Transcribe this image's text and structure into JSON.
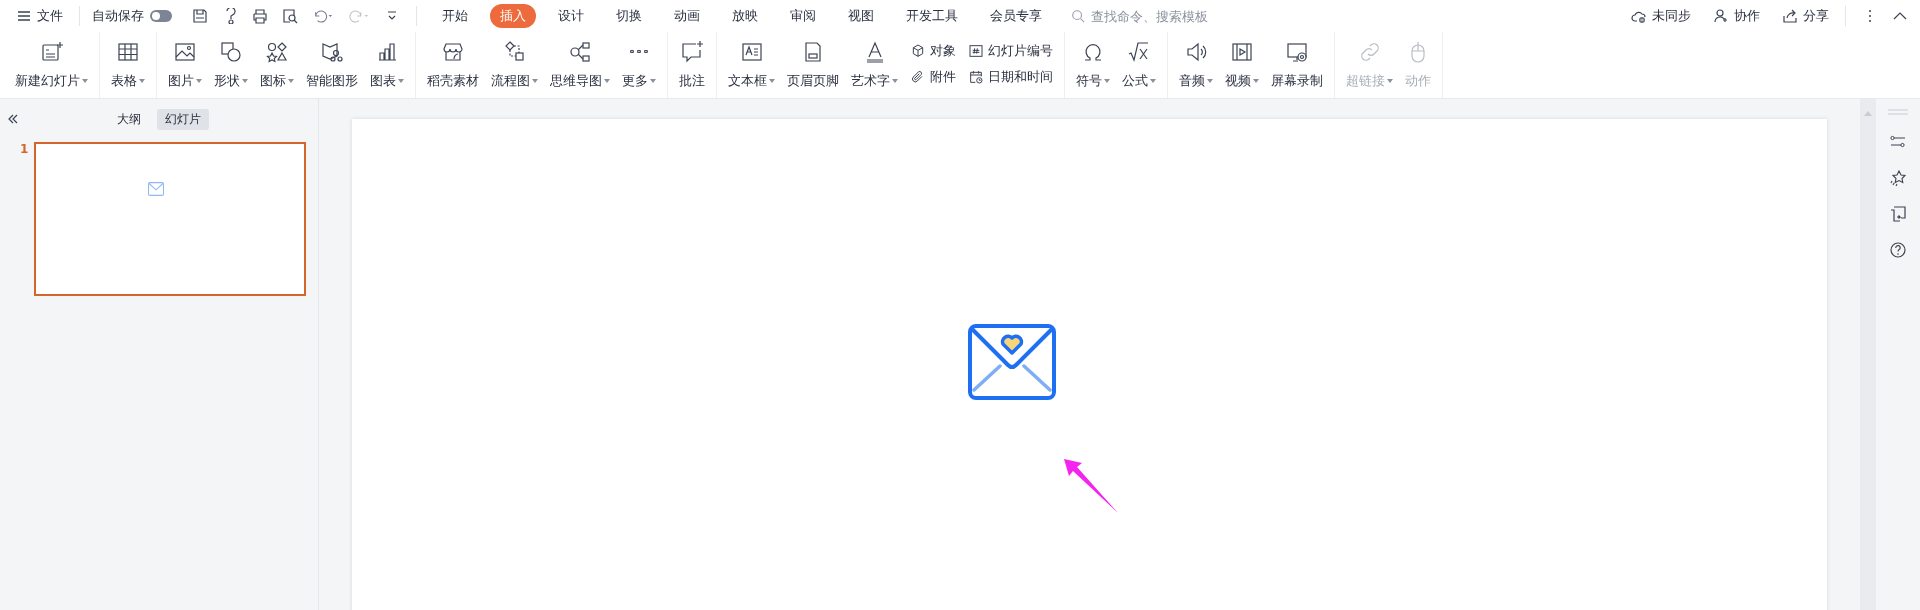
{
  "title_bar": {
    "file_menu": "文件",
    "autosave": {
      "label": "自动保存",
      "on": false
    }
  },
  "tabs": [
    {
      "label": "开始",
      "selected": false
    },
    {
      "label": "插入",
      "selected": true
    },
    {
      "label": "设计",
      "selected": false
    },
    {
      "label": "切换",
      "selected": false
    },
    {
      "label": "动画",
      "selected": false
    },
    {
      "label": "放映",
      "selected": false
    },
    {
      "label": "审阅",
      "selected": false
    },
    {
      "label": "视图",
      "selected": false
    },
    {
      "label": "开发工具",
      "selected": false
    },
    {
      "label": "会员专享",
      "selected": false
    }
  ],
  "search": {
    "placeholder": "查找命令、搜索模板"
  },
  "top_actions": [
    "未同步",
    "协作",
    "分享"
  ],
  "ribbon": [
    [
      {
        "kind": "large",
        "label": "新建幻灯片",
        "dropdown": true,
        "disabled": false
      }
    ],
    [
      {
        "kind": "large",
        "label": "表格",
        "dropdown": true,
        "disabled": false
      }
    ],
    [
      {
        "kind": "large",
        "label": "图片",
        "dropdown": true,
        "disabled": false
      },
      {
        "kind": "large",
        "label": "形状",
        "dropdown": true,
        "disabled": false
      },
      {
        "kind": "large",
        "label": "图标",
        "dropdown": true,
        "disabled": false
      },
      {
        "kind": "large",
        "label": "智能图形",
        "dropdown": false,
        "disabled": false
      },
      {
        "kind": "large",
        "label": "图表",
        "dropdown": true,
        "disabled": false
      }
    ],
    [
      {
        "kind": "large",
        "label": "稻壳素材",
        "dropdown": false,
        "disabled": false
      },
      {
        "kind": "large",
        "label": "流程图",
        "dropdown": true,
        "disabled": false
      },
      {
        "kind": "large",
        "label": "思维导图",
        "dropdown": true,
        "disabled": false
      },
      {
        "kind": "large",
        "label": "更多",
        "dropdown": true,
        "disabled": false
      }
    ],
    [
      {
        "kind": "large",
        "label": "批注",
        "dropdown": false,
        "disabled": false
      }
    ],
    [
      {
        "kind": "large",
        "label": "文本框",
        "dropdown": true,
        "disabled": false
      },
      {
        "kind": "large",
        "label": "页眉页脚",
        "dropdown": false,
        "disabled": false
      },
      {
        "kind": "large",
        "label": "艺术字",
        "dropdown": true,
        "disabled": false
      },
      {
        "kind": "small",
        "label": "对象",
        "dropdown": false,
        "disabled": false
      },
      {
        "kind": "small",
        "label": "附件",
        "dropdown": false,
        "disabled": false
      },
      {
        "kind": "small",
        "label": "幻灯片编号",
        "dropdown": false,
        "disabled": false
      },
      {
        "kind": "small",
        "label": "日期和时间",
        "dropdown": false,
        "disabled": false
      }
    ],
    [
      {
        "kind": "large",
        "label": "符号",
        "dropdown": true,
        "disabled": false
      },
      {
        "kind": "large",
        "label": "公式",
        "dropdown": true,
        "disabled": false
      }
    ],
    [
      {
        "kind": "large",
        "label": "音频",
        "dropdown": true,
        "disabled": false
      },
      {
        "kind": "large",
        "label": "视频",
        "dropdown": true,
        "disabled": false
      },
      {
        "kind": "large",
        "label": "屏幕录制",
        "dropdown": false,
        "disabled": false
      }
    ],
    [
      {
        "kind": "large",
        "label": "超链接",
        "dropdown": true,
        "disabled": true
      },
      {
        "kind": "large",
        "label": "动作",
        "dropdown": false,
        "disabled": true
      }
    ]
  ],
  "panel_tabs": [
    {
      "label": "大纲",
      "selected": false
    },
    {
      "label": "幻灯片",
      "selected": true
    }
  ],
  "slides": [
    {
      "number": "1",
      "selected": true
    }
  ]
}
